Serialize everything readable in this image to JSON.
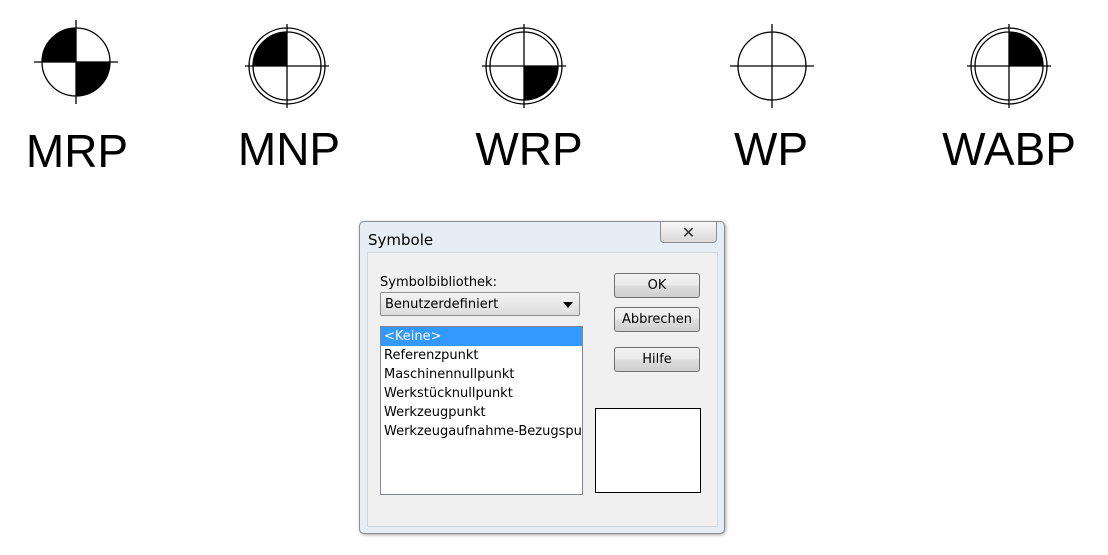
{
  "symbols": [
    {
      "label": "MRP",
      "icon": "mrp-symbol-icon"
    },
    {
      "label": "MNP",
      "icon": "mnp-symbol-icon"
    },
    {
      "label": "WRP",
      "icon": "wrp-symbol-icon"
    },
    {
      "label": "WP",
      "icon": "wp-symbol-icon"
    },
    {
      "label": "WABP",
      "icon": "wabp-symbol-icon"
    }
  ],
  "dialog": {
    "title": "Symbole",
    "close_icon": "close-icon",
    "library_label": "Symbolbibliothek:",
    "library_selected": "Benutzerdefiniert",
    "list_items": [
      "<Keine>",
      "Referenzpunkt",
      "Maschinennullpunkt",
      "Werkstücknullpunkt",
      "Werkzeugpunkt",
      "Werkzeugaufnahme-Bezugspunkt"
    ],
    "selected_index": 0,
    "ok_label": "OK",
    "cancel_label": "Abbrechen",
    "help_label": "Hilfe"
  },
  "colors": {
    "selection": "#3399ff",
    "dialog_frame": "#e6edf4",
    "symbol_fill": "#000000"
  }
}
